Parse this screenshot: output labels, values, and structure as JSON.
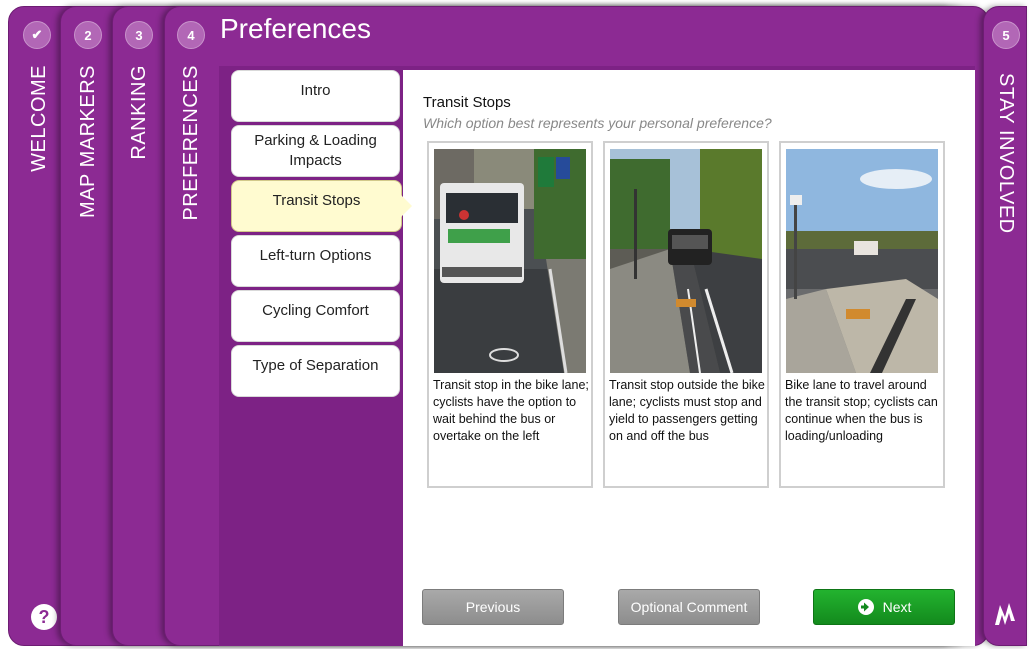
{
  "steps": [
    {
      "badge": "✔",
      "label": "WELCOME"
    },
    {
      "badge": "2",
      "label": "MAP MARKERS"
    },
    {
      "badge": "3",
      "label": "RANKING"
    },
    {
      "badge": "4",
      "label": "PREFERENCES"
    },
    {
      "badge": "5",
      "label": "STAY INVOLVED"
    }
  ],
  "page_title": "Preferences",
  "nav_items": [
    {
      "label": "Intro"
    },
    {
      "label": "Parking & Loading Impacts"
    },
    {
      "label": "Transit Stops"
    },
    {
      "label": "Left-turn Options"
    },
    {
      "label": "Cycling Comfort"
    },
    {
      "label": "Type of Separation"
    }
  ],
  "active_nav": "Transit Stops",
  "section": {
    "title": "Transit Stops",
    "subtitle": "Which option best represents your personal preference?"
  },
  "options": [
    {
      "caption": "Transit stop in the bike lane; cyclists have the option to wait behind the bus or overtake on the left"
    },
    {
      "caption": "Transit stop outside the bike lane; cyclists must stop and yield to passengers getting on and off the bus"
    },
    {
      "caption": "Bike lane to travel around the transit stop; cyclists can continue when the bus is loading/unloading"
    }
  ],
  "buttons": {
    "previous": "Previous",
    "optional_comment": "Optional Comment",
    "next": "Next"
  },
  "help_icon_glyph": "?",
  "colors": {
    "panel_purple": "#8c2a93",
    "active_nav": "#fffbd0",
    "next_green": "#1ea329",
    "gray_button": "#999999"
  },
  "icons": [
    "check-icon",
    "help-icon",
    "next-arrow-icon",
    "logo-icon"
  ]
}
